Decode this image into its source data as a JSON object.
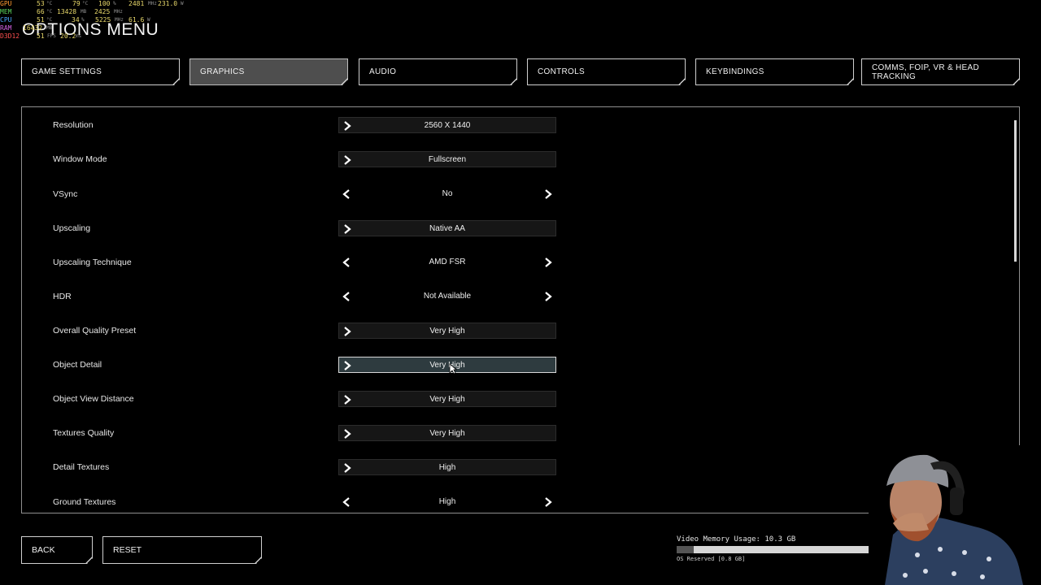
{
  "osd": [
    {
      "label": "GPU",
      "v1": "53",
      "u1": "°C",
      "v2": "79",
      "u2": "°C",
      "v3": "100",
      "u3": "%",
      "v4": "2481",
      "u4": "MHz",
      "v5": "231.0",
      "u5": "W"
    },
    {
      "label": "MEM",
      "v1": "66",
      "u1": "°C",
      "v2": "13428",
      "u2": "MB",
      "v3": "2425",
      "u3": "MHz"
    },
    {
      "label": "CPU",
      "v1": "51",
      "u1": "°C",
      "v2": "34",
      "u2": "%",
      "v3": "5225",
      "u3": "MHz",
      "v4": "61.6",
      "u4": "W"
    },
    {
      "label": "RAM",
      "v1": "16432",
      "u1": "MB"
    },
    {
      "label": "D3D12",
      "v1": "51",
      "u1": "FPS",
      "v2": "20.2",
      "u2": "ms"
    }
  ],
  "title": "OPTIONS MENU",
  "tabs": [
    {
      "label": "GAME SETTINGS",
      "active": false
    },
    {
      "label": "GRAPHICS",
      "active": true
    },
    {
      "label": "AUDIO",
      "active": false
    },
    {
      "label": "CONTROLS",
      "active": false
    },
    {
      "label": "KEYBINDINGS",
      "active": false
    },
    {
      "label": "COMMS, FOIP, VR & HEAD TRACKING",
      "active": false
    }
  ],
  "settings": [
    {
      "label": "Resolution",
      "value": "2560 X 1440",
      "type": "dropdown"
    },
    {
      "label": "Window Mode",
      "value": "Fullscreen",
      "type": "dropdown"
    },
    {
      "label": "VSync",
      "value": "No",
      "type": "selector"
    },
    {
      "label": "Upscaling",
      "value": "Native AA",
      "type": "dropdown"
    },
    {
      "label": "Upscaling Technique",
      "value": "AMD FSR",
      "type": "selector"
    },
    {
      "label": "HDR",
      "value": "Not Available",
      "type": "selector"
    },
    {
      "label": "Overall Quality Preset",
      "value": "Very High",
      "type": "dropdown"
    },
    {
      "label": "Object Detail",
      "value": "Very High",
      "type": "dropdown",
      "highlight": true
    },
    {
      "label": "Object View Distance",
      "value": "Very High",
      "type": "dropdown"
    },
    {
      "label": "Textures Quality",
      "value": "Very High",
      "type": "dropdown"
    },
    {
      "label": "Detail Textures",
      "value": "High",
      "type": "dropdown"
    },
    {
      "label": "Ground Textures",
      "value": "High",
      "type": "selector"
    }
  ],
  "footer": {
    "back_label": "BACK",
    "reset_label": "RESET",
    "vram_label": "Video Memory Usage: 10.3 GB",
    "vram_usage_fraction": 0.9,
    "vram_reserved": "OS Reserved [0.8 GB]"
  },
  "colors": {
    "background": "#000000",
    "active_tab": "#4e4e4e",
    "highlight_control": "#2e3b3f"
  }
}
